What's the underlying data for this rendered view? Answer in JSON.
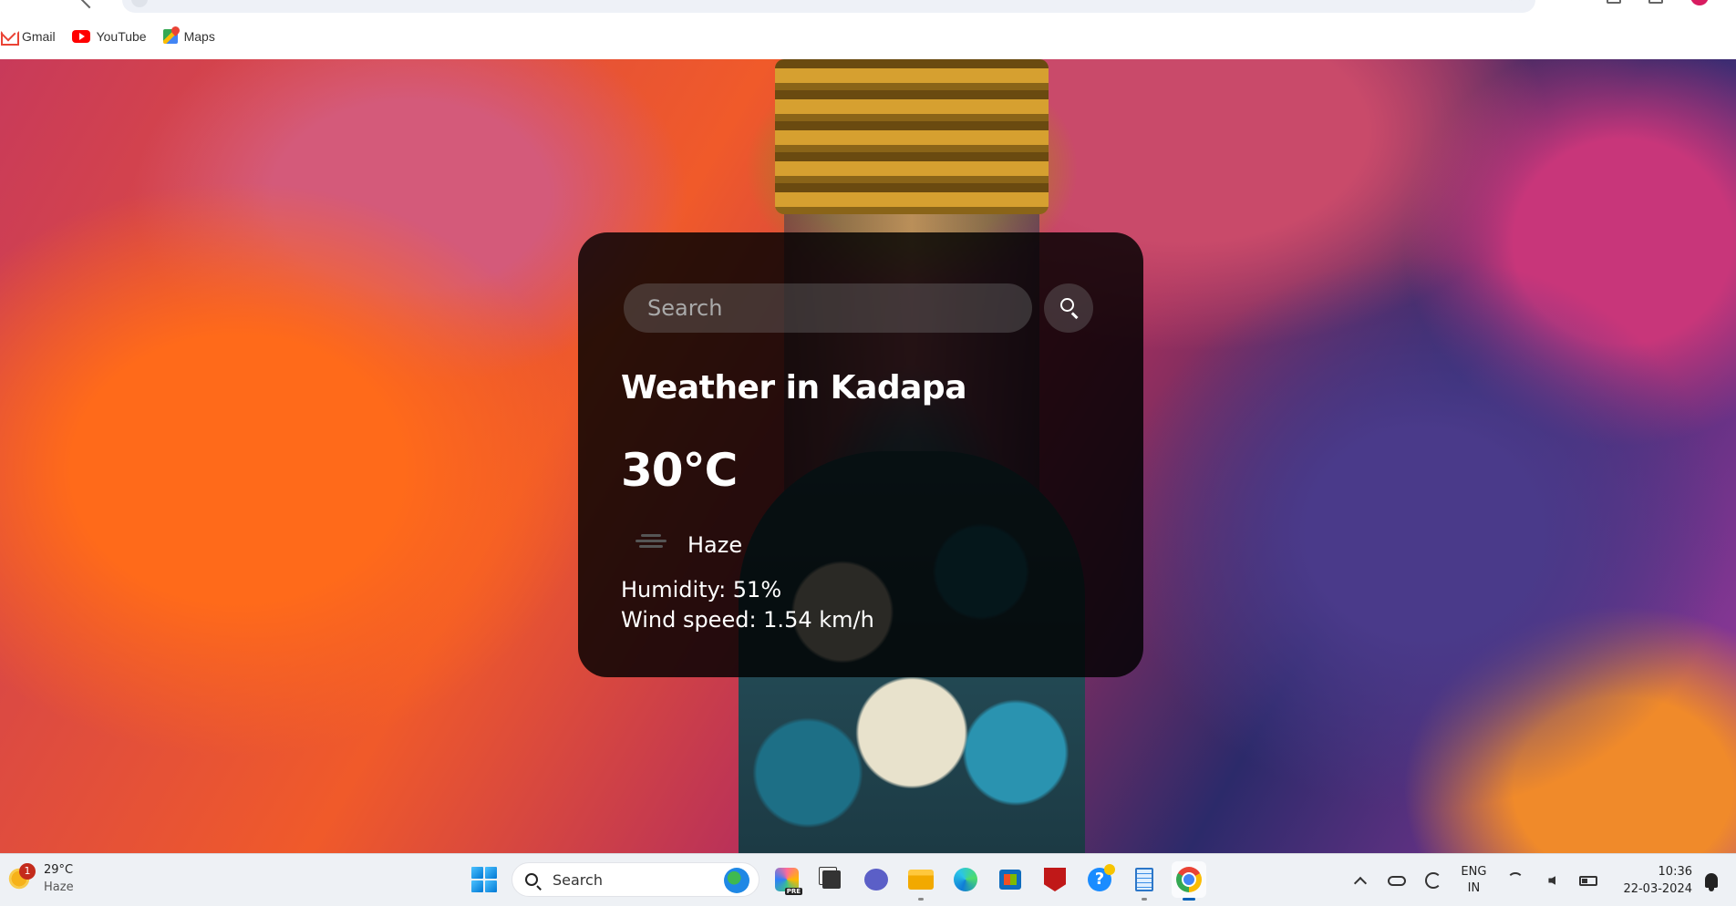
{
  "bookmarks": [
    {
      "label": "Gmail",
      "icon": "gmail-icon"
    },
    {
      "label": "YouTube",
      "icon": "youtube-icon"
    },
    {
      "label": "Maps",
      "icon": "maps-icon"
    }
  ],
  "weather_card": {
    "search_placeholder": "Search",
    "city_title": "Weather in Kadapa",
    "temperature": "30°C",
    "condition": "Haze",
    "humidity": "Humidity: 51%",
    "wind": "Wind speed: 1.54 km/h",
    "icon": "haze-icon"
  },
  "taskbar": {
    "weather": {
      "temp": "29°C",
      "condition": "Haze",
      "badge": "1"
    },
    "search_label": "Search",
    "apps": [
      "start",
      "copilot",
      "task-view",
      "chat",
      "file-explorer",
      "edge",
      "store",
      "mcafee",
      "get-help",
      "notepad",
      "chrome"
    ],
    "language": {
      "line1": "ENG",
      "line2": "IN"
    },
    "time": "10:36",
    "date": "22-03-2024"
  },
  "colors": {
    "card_bg": "#000000",
    "taskbar_bg": "#eef1f5",
    "accent": "#005fb8"
  }
}
